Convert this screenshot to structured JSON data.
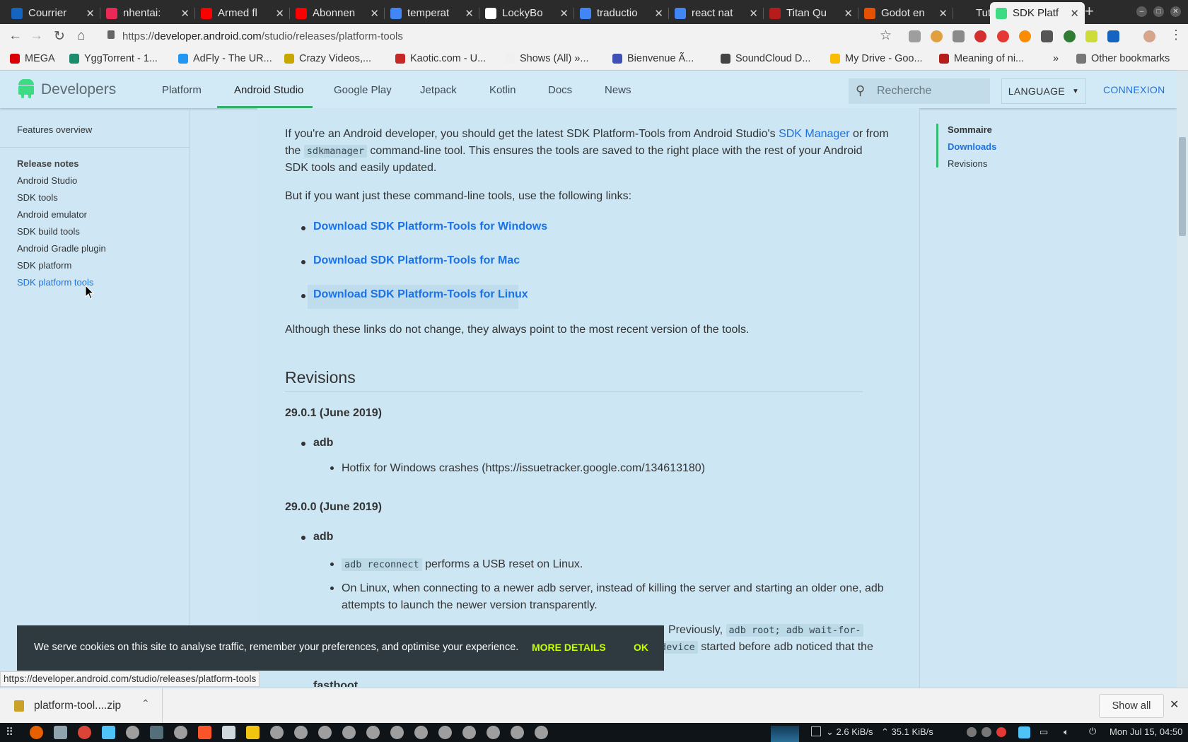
{
  "browser": {
    "tabs": [
      {
        "title": "Courrier",
        "color": "#1565c0"
      },
      {
        "title": "nhentai:",
        "color": "#ec2854"
      },
      {
        "title": "Armed fl",
        "color": "#ff0000"
      },
      {
        "title": "Abonnen",
        "color": "#ff0000"
      },
      {
        "title": "temperat",
        "color": "#4285f4"
      },
      {
        "title": "LockyBo",
        "color": "#ffffff"
      },
      {
        "title": "traductio",
        "color": "#4285f4"
      },
      {
        "title": "react nat",
        "color": "#4285f4"
      },
      {
        "title": "Titan Qu",
        "color": "#b71c1c"
      },
      {
        "title": "Godot en",
        "color": "#e65100"
      },
      {
        "title": "TutuApp",
        "color": "#2b2b2b"
      }
    ],
    "active_tab": {
      "title": "SDK Platf",
      "color": "#3ddc84"
    },
    "new_tab_label": "+",
    "url": {
      "scheme": "https://",
      "host": "developer.android.com",
      "path": "/studio/releases/platform-tools"
    },
    "bookmarks": [
      {
        "label": "MEGA",
        "color": "#d90007"
      },
      {
        "label": "YggTorrent - 1...",
        "color": "#1b8c6e"
      },
      {
        "label": "AdFly - The UR...",
        "color": "#2196f3"
      },
      {
        "label": "Crazy Videos,...",
        "color": "#c8a800"
      },
      {
        "label": "Kaotic.com - U...",
        "color": "#c62828"
      },
      {
        "label": "Shows (All) »...",
        "color": "#f0f0f0"
      },
      {
        "label": "Bienvenue Ã...",
        "color": "#3f51b5"
      },
      {
        "label": "SoundCloud D...",
        "color": "#444444"
      },
      {
        "label": "My Drive - Goo...",
        "color": "#fbbc04"
      },
      {
        "label": "Meaning of ni...",
        "color": "#b71c1c"
      }
    ],
    "bookmarks_more": "»",
    "other_bookmarks": "Other bookmarks",
    "status_url": "https://developer.android.com/studio/releases/platform-tools"
  },
  "site": {
    "brand": "Developers",
    "nav": [
      "Platform",
      "Android Studio",
      "Google Play",
      "Jetpack",
      "Kotlin",
      "Docs",
      "News"
    ],
    "search_placeholder": "Recherche",
    "language": "LANGUAGE",
    "signin": "CONNEXION"
  },
  "leftnav": {
    "top_item": "Features overview",
    "section_title": "Release notes",
    "items": [
      "Android Studio",
      "SDK tools",
      "Android emulator",
      "SDK build tools",
      "Android Gradle plugin",
      "SDK platform",
      "SDK platform tools"
    ]
  },
  "toc": {
    "title": "Sommaire",
    "items": [
      "Downloads",
      "Revisions"
    ]
  },
  "content": {
    "intro_a": "If you're an Android developer, you should get the latest SDK Platform-Tools from Android Studio's ",
    "intro_link": "SDK Manager",
    "intro_b": " or from",
    "intro_c": "the ",
    "intro_code": "sdkmanager",
    "intro_d": " command-line tool. This ensures the tools are saved to the right place with the rest of your Android",
    "intro_e": "SDK tools and easily updated.",
    "links_intro": "But if you want just these command-line tools, use the following links:",
    "downloads": [
      "Download SDK Platform-Tools for Windows",
      "Download SDK Platform-Tools for Mac",
      "Download SDK Platform-Tools for Linux"
    ],
    "links_note": "Although these links do not change, they always point to the most recent version of the tools.",
    "revisions_heading": "Revisions",
    "rev1_title": "29.0.1 (June 2019)",
    "rev1_component": "adb",
    "rev1_item": "Hotfix for Windows crashes (https://issuetracker.google.com/134613180)",
    "rev2_title": "29.0.0 (June 2019)",
    "rev2_component": "adb",
    "rev2_item1_code": "adb reconnect",
    "rev2_item1_text": " performs a USB reset on Linux.",
    "rev2_item2_a": "On Linux, when connecting to a newer adb server, instead of killing the server and starting an older one, adb",
    "rev2_item2_b": "attempts to launch the newer version transparently.",
    "rev2_item3_a": "Previously, ",
    "rev2_item3_code1": "adb root; adb wait-for-",
    "rev2_item3_code2": "device",
    "rev2_item3_b": " started before adb noticed that the",
    "rev3_partial": "fastboot"
  },
  "cookie": {
    "text": "We serve cookies on this site to analyse traffic, remember your preferences, and optimise your experience.",
    "more": "MORE DETAILS",
    "ok": "OK"
  },
  "download_shelf": {
    "file": "platform-tool....zip",
    "show_all": "Show all"
  },
  "taskbar": {
    "network": "2.6 KiB/s",
    "upload": "35.1 KiB/s",
    "clock": "Mon Jul 15, 04:50"
  },
  "colors": {
    "accent": "#1a73e8",
    "android_green": "#3ddc84",
    "cookie_link": "#c6ff00"
  }
}
